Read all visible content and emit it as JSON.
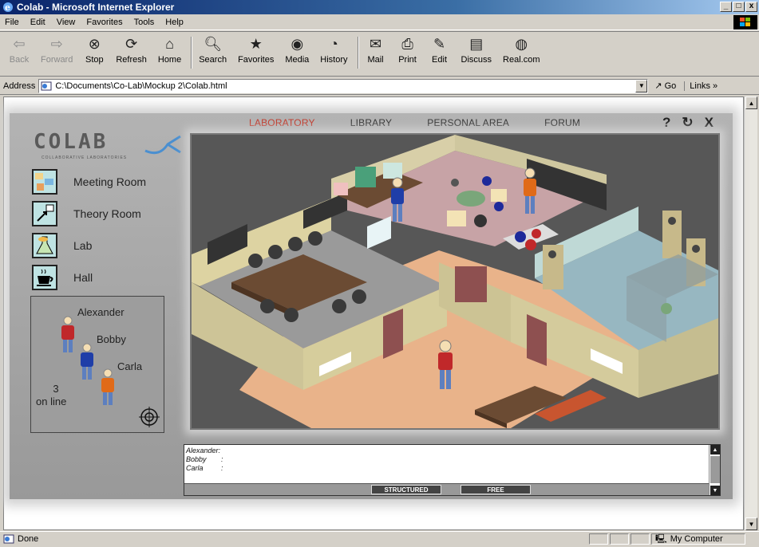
{
  "window": {
    "title": "Colab - Microsoft Internet Explorer",
    "controls": [
      "_",
      "□",
      "x"
    ]
  },
  "menu": [
    "File",
    "Edit",
    "View",
    "Favorites",
    "Tools",
    "Help"
  ],
  "toolbar": [
    {
      "label": "Back",
      "icon": "back-arrow-icon",
      "enabled": false
    },
    {
      "label": "Forward",
      "icon": "forward-arrow-icon",
      "enabled": false
    },
    {
      "label": "Stop",
      "icon": "stop-icon",
      "enabled": true
    },
    {
      "label": "Refresh",
      "icon": "refresh-icon",
      "enabled": true
    },
    {
      "label": "Home",
      "icon": "home-icon",
      "enabled": true
    },
    {
      "label": "Search",
      "icon": "search-icon",
      "enabled": true
    },
    {
      "label": "Favorites",
      "icon": "favorites-icon",
      "enabled": true
    },
    {
      "label": "Media",
      "icon": "media-icon",
      "enabled": true
    },
    {
      "label": "History",
      "icon": "history-icon",
      "enabled": true
    },
    {
      "label": "Mail",
      "icon": "mail-icon",
      "enabled": true
    },
    {
      "label": "Print",
      "icon": "print-icon",
      "enabled": true
    },
    {
      "label": "Edit",
      "icon": "edit-icon",
      "enabled": true
    },
    {
      "label": "Discuss",
      "icon": "discuss-icon",
      "enabled": true
    },
    {
      "label": "Real.com",
      "icon": "real-icon",
      "enabled": true
    }
  ],
  "address": {
    "label": "Address",
    "value": "C:\\Documents\\Co-Lab\\Mockup 2\\Colab.html",
    "go": "Go",
    "links": "Links »"
  },
  "status": {
    "text": "Done",
    "zone": "My Computer"
  },
  "app": {
    "logo_text": "COLAB",
    "logo_sub": "COLLABORATIVE LABORATORIES",
    "nav": [
      "LABORATORY",
      "LIBRARY",
      "PERSONAL AREA",
      "FORUM"
    ],
    "active_nav": "LABORATORY",
    "util": [
      "?",
      "↻",
      "X"
    ],
    "rooms": [
      {
        "label": "Meeting Room",
        "icon": "meeting-room-icon"
      },
      {
        "label": "Theory Room",
        "icon": "theory-room-icon"
      },
      {
        "label": "Lab",
        "icon": "lab-flask-icon"
      },
      {
        "label": "Hall",
        "icon": "coffee-cup-icon"
      }
    ],
    "online": {
      "users": [
        "Alexander",
        "Bobby",
        "Carla"
      ],
      "count": "3",
      "label": "on line"
    },
    "chat": {
      "lines": [
        {
          "name": "Alexander:"
        },
        {
          "name": "Bobby",
          "sep": ":"
        },
        {
          "name": "Carla",
          "sep": ":"
        }
      ],
      "tabs": [
        "STRUCTURED",
        "FREE"
      ]
    },
    "colors": {
      "active_nav": "#c0392b",
      "person_red": "#c0282a",
      "person_blue": "#1f3ea8",
      "person_orange": "#e06a18"
    }
  }
}
